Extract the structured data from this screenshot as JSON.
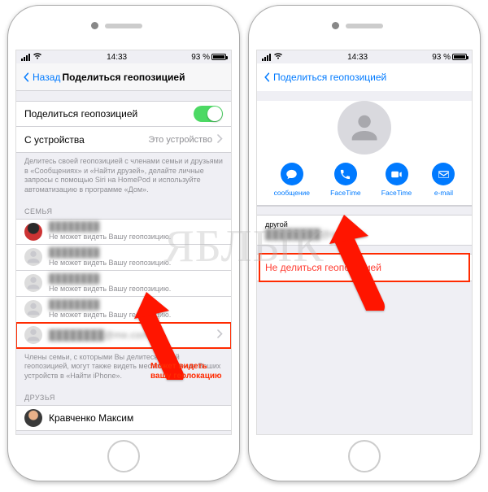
{
  "status_bar": {
    "time": "14:33",
    "battery": "93 %"
  },
  "left": {
    "back": "Назад",
    "title": "Поделиться геопозицией",
    "share_row": "Поделиться геопозицией",
    "device_row_label": "С устройства",
    "device_row_value": "Это устройство",
    "share_note": "Делитесь своей геопозицией с членами семьи и друзьями в «Сообщениях» и «Найти друзей», делайте личные запросы с помощью Siri на HomePod и используйте автоматизацию в программе «Дом».",
    "family_header": "СЕМЬЯ",
    "family": [
      {
        "name": "████████",
        "sub": "Не может видеть Вашу геопозицию."
      },
      {
        "name": "████████",
        "sub": "Не может видеть Вашу геопозицию."
      },
      {
        "name": "████████",
        "sub": "Не может видеть Вашу геопозицию."
      },
      {
        "name": "████████",
        "sub": "Не может видеть Вашу геопозицию."
      },
      {
        "name": "████████@me.com",
        "sub": ""
      }
    ],
    "family_note": "Члены семьи, с которыми Вы делитесь своей геопозицией, могут также видеть местоположение Ваших устройств в «Найти iPhone».",
    "friends_header": "ДРУЗЬЯ",
    "friends": [
      {
        "name": "Кравченко Максим"
      }
    ],
    "annotation": "Может видеть\nвашу геолокацию"
  },
  "right": {
    "back": "Поделиться геопозицией",
    "actions": {
      "message": "сообщение",
      "facetime_audio": "FaceTime",
      "facetime_video": "FaceTime",
      "email": "e-mail"
    },
    "field_label": "другой",
    "field_value": "████████@me.com",
    "stop_sharing": "Не делиться геопозицией"
  },
  "watermark": "ЯБЛЫК",
  "colors": {
    "ios_blue": "#007aff",
    "ios_green": "#4cd964",
    "ios_red": "#ff3b30",
    "highlight": "#ff2a00"
  }
}
